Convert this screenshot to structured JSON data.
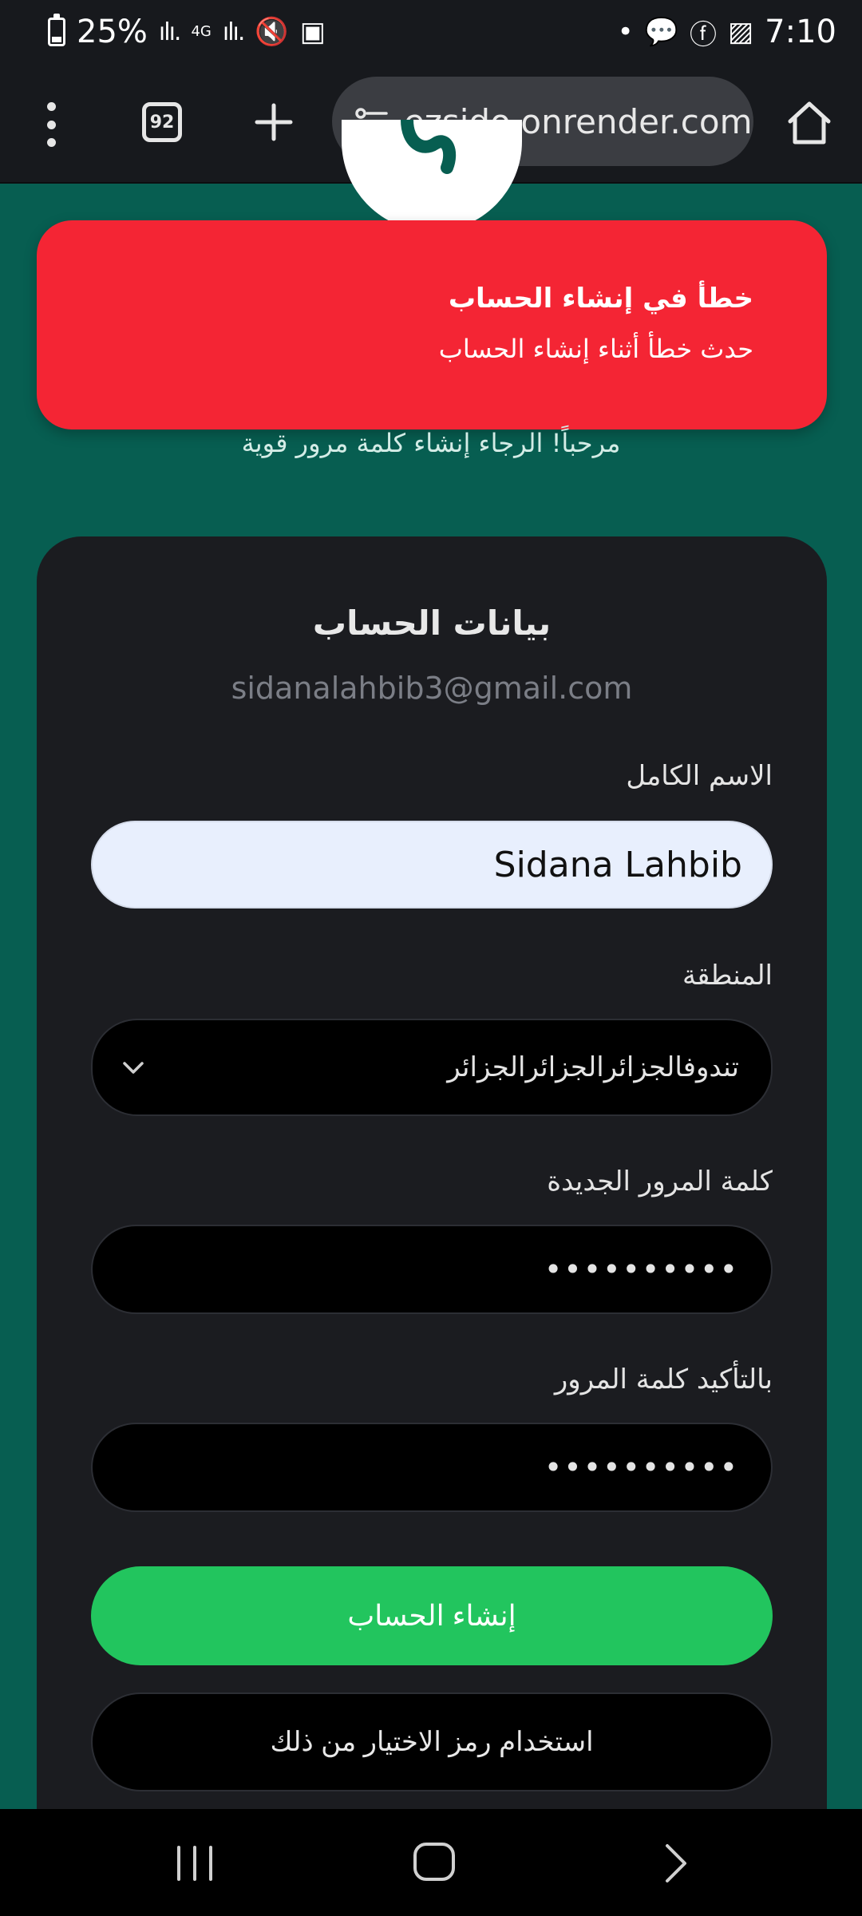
{
  "status_bar": {
    "battery": "25%",
    "network": "4G",
    "time": "7:10"
  },
  "browser": {
    "tab_count": "92",
    "url": "ezsido.onrender.com"
  },
  "toast": {
    "title": "خطأ في إنشاء الحساب",
    "message": "حدث خطأ أثناء إنشاء الحساب"
  },
  "welcome": "مرحباً! الرجاء إنشاء كلمة مرور قوية",
  "form": {
    "title": "بيانات الحساب",
    "email": "sidanalahbib3@gmail.com",
    "full_name_label": "الاسم الكامل",
    "full_name_value": "Sidana Lahbib",
    "region_label": "المنطقة",
    "region_value": "تندوفالجزائرالجزائرالجزائر",
    "new_password_label": "كلمة المرور الجديدة",
    "new_password_value": "••••••••••",
    "confirm_password_label": "بالتأكيد كلمة المرور",
    "confirm_password_value": "••••••••••",
    "submit_label": "إنشاء الحساب",
    "alt_label": "استخدام رمز الاختيار من ذلك"
  },
  "colors": {
    "page_bg": "#075e51",
    "error": "#f42534",
    "card": "#1b1c20",
    "primary": "#22c55e"
  }
}
